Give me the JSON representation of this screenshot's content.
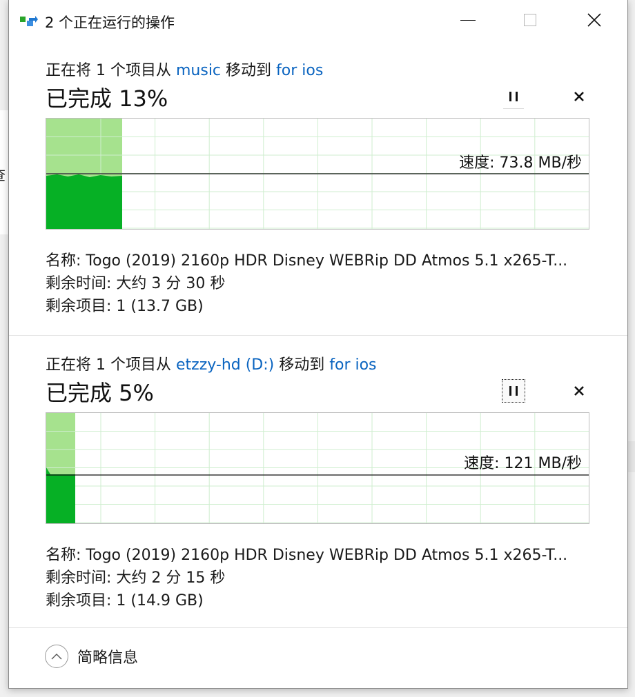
{
  "background": {
    "fragment_text": "查"
  },
  "window": {
    "title": "2 个正在运行的操作",
    "controls": {
      "minimize": "minimize",
      "maximize": "maximize",
      "close": "close"
    }
  },
  "operations": [
    {
      "prefix": "正在将 1 个项目从 ",
      "source": "music",
      "middle": " 移动到 ",
      "destination": "for ios",
      "percent_text": "已完成 13%",
      "percent": 13,
      "speed_text": "速度: 73.8 MB/秒",
      "name_text": "名称:  Togo (2019) 2160p HDR Disney WEBRip DD Atmos 5.1 x265-T...",
      "time_text": "剩余时间:  大约 3 分 30 秒",
      "items_text": "剩余项目:  1 (13.7 GB)",
      "pause_focused": false
    },
    {
      "prefix": "正在将 1 个项目从 ",
      "source": "etzzy-hd (D:)",
      "middle": " 移动到 ",
      "destination": "for ios",
      "percent_text": "已完成 5%",
      "percent": 5,
      "speed_text": "速度: 121 MB/秒",
      "name_text": "名称:  Togo (2019) 2160p HDR Disney WEBRip DD Atmos 5.1 x265-T...",
      "time_text": "剩余时间:  大约 2 分 15 秒",
      "items_text": "剩余项目:  1 (14.9 GB)",
      "pause_focused": true
    }
  ],
  "footer": {
    "details_label": "简略信息"
  },
  "icons": {
    "app": "file-move-icon",
    "pause": "pause-icon",
    "cancel": "close-icon",
    "details": "chevron-up-icon"
  },
  "colors": {
    "progress_light": "#a6e28e",
    "progress_dark": "#06b025",
    "grid": "#cfeecf",
    "link": "#0a64c0"
  }
}
